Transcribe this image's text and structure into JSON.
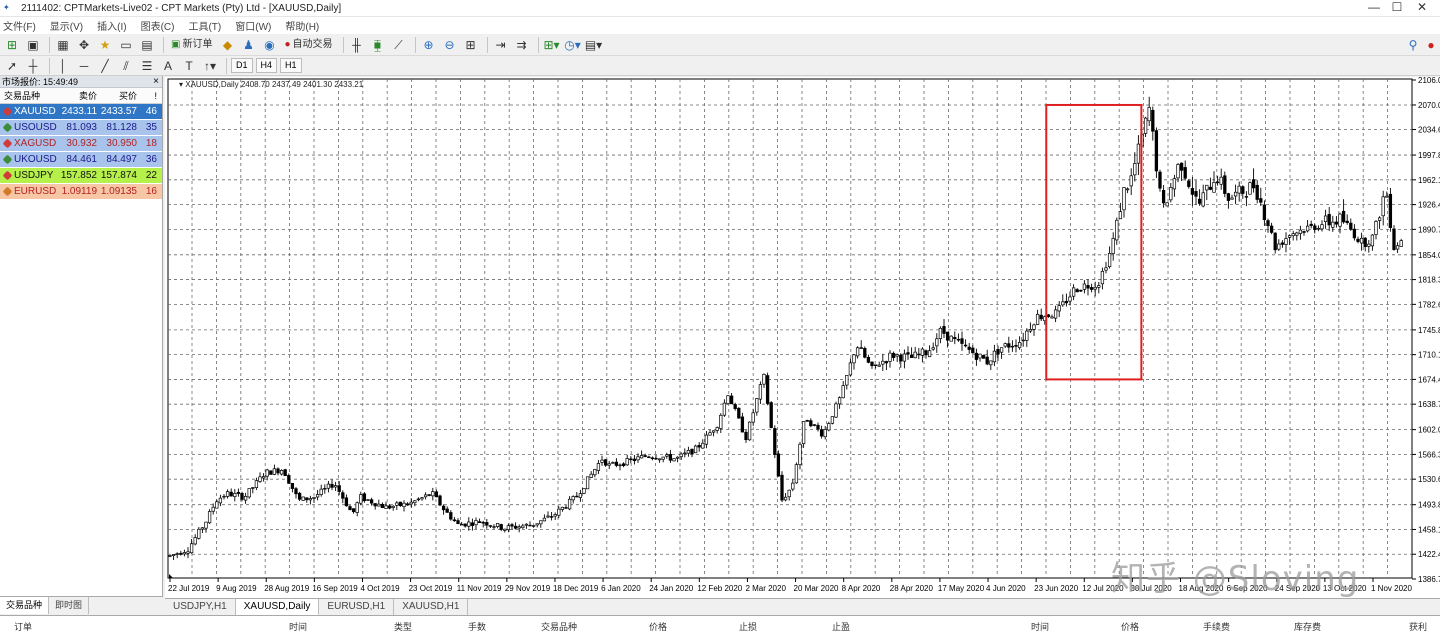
{
  "window": {
    "title": "2111402: CPTMarkets-Live02 - CPT Markets (Pty) Ltd - [XAUUSD,Daily]",
    "app_icon": "mt4-app-icon",
    "controls": [
      "—",
      "☐",
      "✕"
    ]
  },
  "menu": [
    "文件(F)",
    "显示(V)",
    "插入(I)",
    "图表(C)",
    "工具(T)",
    "窗口(W)",
    "帮助(H)"
  ],
  "toolbar": {
    "new_order_label": "新订单",
    "auto_trade_label": "自动交易",
    "timeframes": [
      "D1",
      "H4",
      "H1"
    ],
    "text_tool": "A",
    "text_label_tool": "T"
  },
  "market_watch": {
    "title": "市场报价: 15:49:49",
    "close": "×",
    "columns": {
      "symbol": "交易品种",
      "bid": "卖价",
      "ask": "买价",
      "spread": "!"
    },
    "rows": [
      {
        "symbol": "XAUUSD",
        "bid": "2433.11",
        "ask": "2433.57",
        "spread": "46",
        "bg": "#2f76c6",
        "fg": "#ffffff",
        "icon": "#d23b3b"
      },
      {
        "symbol": "USOUSD",
        "bid": "81.093",
        "ask": "81.128",
        "spread": "35",
        "bg": "#a9c4ec",
        "fg": "#1a1a8c",
        "icon": "#3b8d3b"
      },
      {
        "symbol": "XAGUSD",
        "bid": "30.932",
        "ask": "30.950",
        "spread": "18",
        "bg": "#a9c4ec",
        "fg": "#b22222",
        "icon": "#d23b3b"
      },
      {
        "symbol": "UKOUSD",
        "bid": "84.461",
        "ask": "84.497",
        "spread": "36",
        "bg": "#a9c4ec",
        "fg": "#1a1a8c",
        "icon": "#3b8d3b"
      },
      {
        "symbol": "USDJPY",
        "bid": "157.852",
        "ask": "157.874",
        "spread": "22",
        "bg": "#b6f04a",
        "fg": "#111111",
        "icon": "#d23b3b"
      },
      {
        "symbol": "EURUSD",
        "bid": "1.09119",
        "ask": "1.09135",
        "spread": "16",
        "bg": "#f7c7a5",
        "fg": "#b22222",
        "icon": "#d27a2a"
      }
    ],
    "tabs": [
      "交易品种",
      "即时图"
    ]
  },
  "chart": {
    "info": "XAUUSD,Daily  2408.70 2437.49 2401.30 2433.21",
    "watermark": "知乎 @Sloving",
    "highlight_color": "#e02020",
    "price_ticks": [
      "2106.0",
      "2070.0",
      "2034.6",
      "1997.8",
      "1962.1",
      "1926.4",
      "1890.7",
      "1854.0",
      "1818.3",
      "1782.6",
      "1745.8",
      "1710.1",
      "1674.4",
      "1638.7",
      "1602.0",
      "1566.3",
      "1530.6",
      "1493.8",
      "1458.1",
      "1422.4",
      "1386.7"
    ],
    "date_ticks": [
      "22 Jul 2019",
      "9 Aug 2019",
      "28 Aug 2019",
      "16 Sep 2019",
      "4 Oct 2019",
      "23 Oct 2019",
      "11 Nov 2019",
      "29 Nov 2019",
      "18 Dec 2019",
      "6 Jan 2020",
      "24 Jan 2020",
      "12 Feb 2020",
      "2 Mar 2020",
      "20 Mar 2020",
      "8 Apr 2020",
      "28 Apr 2020",
      "17 May 2020",
      "4 Jun 2020",
      "23 Jun 2020",
      "12 Jul 2020",
      "30 Jul 2020",
      "18 Aug 2020",
      "6 Sep 2020",
      "24 Sep 2020",
      "13 Oct 2020",
      "1 Nov 2020"
    ],
    "tabs": [
      "USDJPY,H1",
      "XAUUSD,Daily",
      "EURUSD,H1",
      "XAUUSD,H1"
    ],
    "active_tab": 1
  },
  "chart_data": {
    "type": "candlestick",
    "symbol": "XAUUSD",
    "timeframe": "Daily",
    "ylim": [
      1386.7,
      2106.0
    ],
    "x_range": [
      "22 Jul 2019",
      "1 Nov 2020"
    ],
    "grid": true,
    "last_bar": {
      "open": 2408.7,
      "high": 2437.49,
      "low": 2401.3,
      "close": 2433.21
    },
    "close_path": [
      [
        "22 Jul 2019",
        1420
      ],
      [
        "29 Jul 2019",
        1430
      ],
      [
        "5 Aug 2019",
        1470
      ],
      [
        "9 Aug 2019",
        1500
      ],
      [
        "13 Aug 2019",
        1510
      ],
      [
        "20 Aug 2019",
        1505
      ],
      [
        "28 Aug 2019",
        1540
      ],
      [
        "4 Sep 2019",
        1545
      ],
      [
        "10 Sep 2019",
        1500
      ],
      [
        "16 Sep 2019",
        1505
      ],
      [
        "24 Sep 2019",
        1525
      ],
      [
        "1 Oct 2019",
        1480
      ],
      [
        "4 Oct 2019",
        1505
      ],
      [
        "14 Oct 2019",
        1490
      ],
      [
        "23 Oct 2019",
        1495
      ],
      [
        "1 Nov 2019",
        1510
      ],
      [
        "6 Nov 2019",
        1485
      ],
      [
        "11 Nov 2019",
        1465
      ],
      [
        "20 Nov 2019",
        1470
      ],
      [
        "29 Nov 2019",
        1460
      ],
      [
        "10 Dec 2019",
        1465
      ],
      [
        "18 Dec 2019",
        1478
      ],
      [
        "27 Dec 2019",
        1505
      ],
      [
        "6 Jan 2020",
        1560
      ],
      [
        "9 Jan 2020",
        1550
      ],
      [
        "15 Jan 2020",
        1555
      ],
      [
        "24 Jan 2020",
        1565
      ],
      [
        "4 Feb 2020",
        1560
      ],
      [
        "12 Feb 2020",
        1575
      ],
      [
        "20 Feb 2020",
        1610
      ],
      [
        "24 Feb 2020",
        1655
      ],
      [
        "2 Mar 2020",
        1590
      ],
      [
        "9 Mar 2020",
        1680
      ],
      [
        "13 Mar 2020",
        1575
      ],
      [
        "16 Mar 2020",
        1500
      ],
      [
        "20 Mar 2020",
        1520
      ],
      [
        "25 Mar 2020",
        1620
      ],
      [
        "1 Apr 2020",
        1595
      ],
      [
        "8 Apr 2020",
        1650
      ],
      [
        "14 Apr 2020",
        1725
      ],
      [
        "20 Apr 2020",
        1690
      ],
      [
        "28 Apr 2020",
        1710
      ],
      [
        "5 May 2020",
        1705
      ],
      [
        "12 May 2020",
        1715
      ],
      [
        "17 May 2020",
        1745
      ],
      [
        "22 May 2020",
        1730
      ],
      [
        "4 Jun 2020",
        1700
      ],
      [
        "9 Jun 2020",
        1720
      ],
      [
        "17 Jun 2020",
        1730
      ],
      [
        "23 Jun 2020",
        1765
      ],
      [
        "1 Jul 2020",
        1770
      ],
      [
        "8 Jul 2020",
        1805
      ],
      [
        "12 Jul 2020",
        1810
      ],
      [
        "17 Jul 2020",
        1812
      ],
      [
        "22 Jul 2020",
        1860
      ],
      [
        "27 Jul 2020",
        1945
      ],
      [
        "30 Jul 2020",
        1965
      ],
      [
        "6 Aug 2020",
        2065
      ],
      [
        "11 Aug 2020",
        1915
      ],
      [
        "18 Aug 2020",
        1990
      ],
      [
        "25 Aug 2020",
        1925
      ],
      [
        "1 Sep 2020",
        1970
      ],
      [
        "6 Sep 2020",
        1935
      ],
      [
        "16 Sep 2020",
        1955
      ],
      [
        "22 Sep 2020",
        1890
      ],
      [
        "24 Sep 2020",
        1865
      ],
      [
        "30 Sep 2020",
        1885
      ],
      [
        "13 Oct 2020",
        1900
      ],
      [
        "20 Oct 2020",
        1905
      ],
      [
        "28 Oct 2020",
        1870
      ],
      [
        "1 Nov 2020",
        1880
      ],
      [
        "6 Nov 2020",
        1950
      ],
      [
        "9 Nov 2020",
        1865
      ],
      [
        "12 Nov 2020",
        1875
      ]
    ],
    "highlight": {
      "from": "23 Jun 2020",
      "to": "30 Jul 2020",
      "price_low": 1674.4,
      "price_high": 2070.0
    }
  },
  "terminal": {
    "columns": [
      "订单",
      "时间",
      "类型",
      "手数",
      "交易品种",
      "价格",
      "止损",
      "止盈",
      "时间",
      "价格",
      "手续费",
      "库存费",
      "获利"
    ]
  }
}
